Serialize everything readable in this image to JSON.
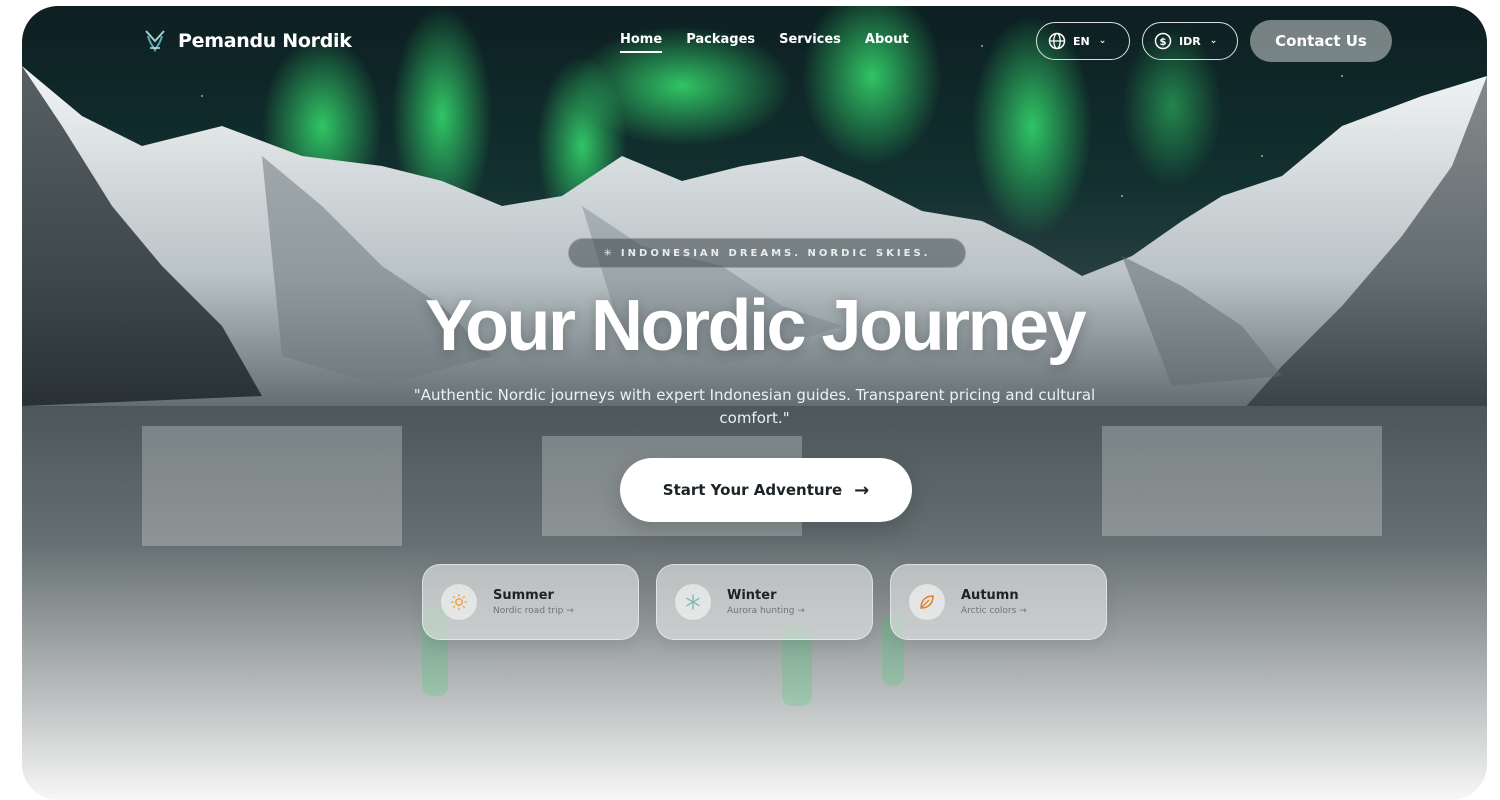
{
  "brand": {
    "name": "Pemandu Nordik"
  },
  "nav": {
    "items": [
      {
        "label": "Home",
        "active": true
      },
      {
        "label": "Packages",
        "active": false
      },
      {
        "label": "Services",
        "active": false
      },
      {
        "label": "About",
        "active": false
      }
    ],
    "language": {
      "value": "EN",
      "icon": "globe-icon"
    },
    "currency": {
      "value": "IDR",
      "icon": "dollar-circle-icon"
    },
    "contact_label": "Contact Us"
  },
  "hero": {
    "eyebrow": "INDONESIAN DREAMS. NORDIC SKIES.",
    "title": "Your Nordic Journey",
    "subtitle": "\"Authentic Nordic journeys with expert Indonesian guides. Transparent pricing and cultural comfort.\"",
    "cta_label": "Start Your Adventure",
    "cta_icon": "arrow-right-icon"
  },
  "seasons": [
    {
      "title": "Summer",
      "subtitle": "Nordic road trip",
      "icon": "sun-icon",
      "color": "#f0a040"
    },
    {
      "title": "Winter",
      "subtitle": "Aurora hunting",
      "icon": "snowflake-icon",
      "color": "#7fb8b0"
    },
    {
      "title": "Autumn",
      "subtitle": "Arctic colors",
      "icon": "leaf-icon",
      "color": "#e07f2a"
    }
  ],
  "colors": {
    "aurora": "#2fd36a",
    "night_sky": "#0d1f22",
    "cta_bg": "#ffffff"
  }
}
